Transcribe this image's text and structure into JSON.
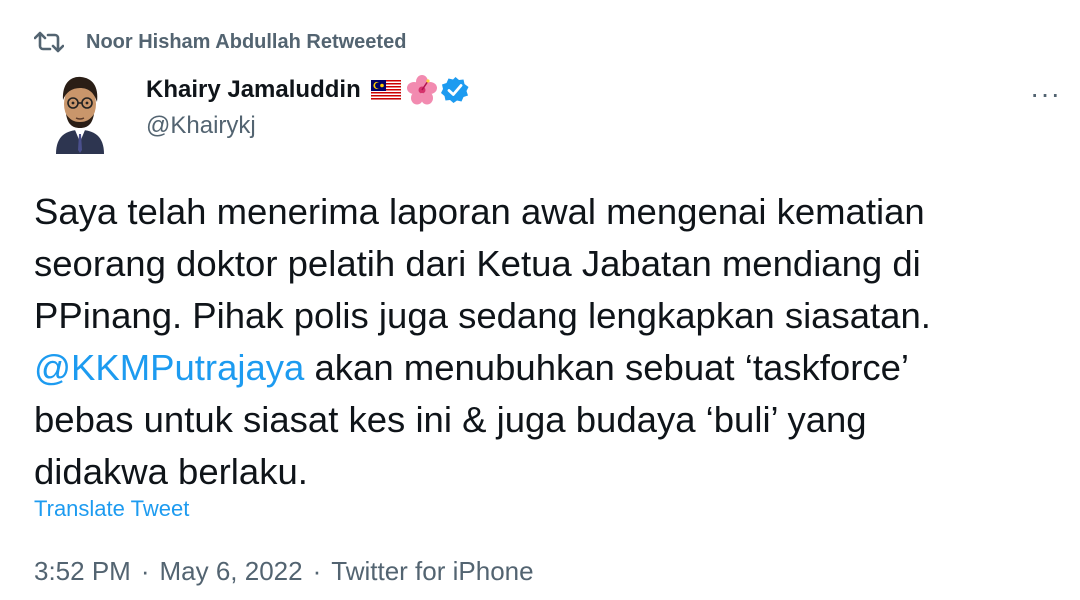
{
  "retweet": {
    "icon": "retweet-icon",
    "label": "Noor Hisham Abdullah Retweeted"
  },
  "author": {
    "name": "Khairy Jamaluddin",
    "handle": "@Khairykj",
    "badges": [
      "malaysia-flag-icon",
      "hibiscus-icon",
      "verified-badge-icon"
    ],
    "verified_color": "#1d9bf0"
  },
  "tweet": {
    "lines": [
      "Saya telah menerima laporan awal mengenai kematian",
      "seorang doktor pelatih dari Ketua Jabatan mendiang di",
      "PPinang. Pihak polis juga sedang lengkapkan siasatan.",
      "bebas untuk siasat kes ini & juga budaya ‘buli’ yang",
      "didakwa berlaku."
    ],
    "mention": "@KKMPutrajaya",
    "mention_rest": " akan menubuhkan sebuat ‘taskforce’"
  },
  "translate_label": "Translate Tweet",
  "meta": {
    "time": "3:52 PM",
    "separator": "·",
    "date": "May 6, 2022",
    "source": "Twitter for iPhone"
  },
  "more_label": "···",
  "colors": {
    "accent": "#1d9bf0",
    "secondary_text": "#536471",
    "text": "#0f1419"
  }
}
